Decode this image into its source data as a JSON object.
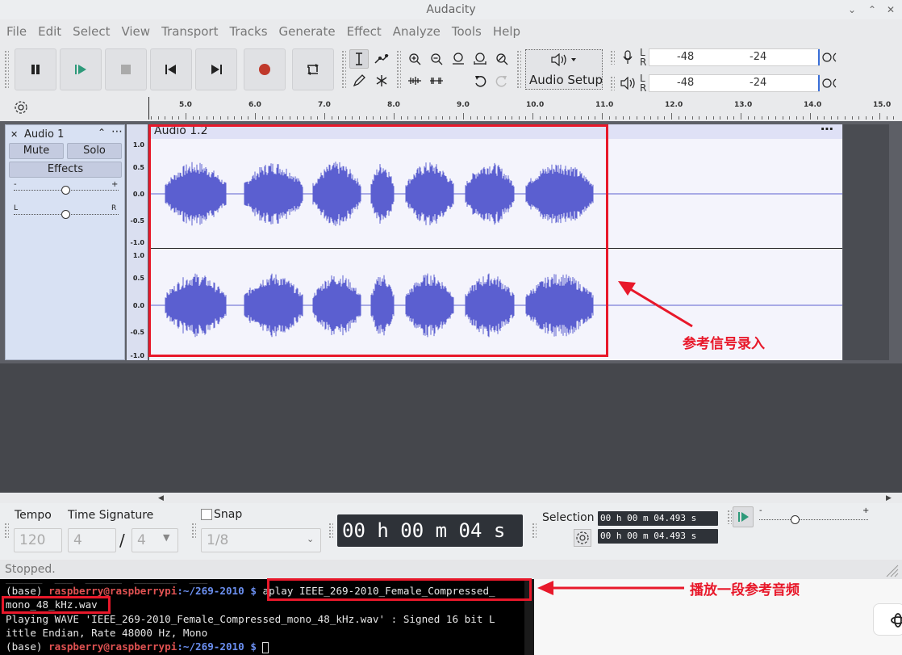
{
  "window": {
    "title": "Audacity"
  },
  "menu": [
    "File",
    "Edit",
    "Select",
    "View",
    "Transport",
    "Tracks",
    "Generate",
    "Effect",
    "Analyze",
    "Tools",
    "Help"
  ],
  "toolbar": {
    "audio_setup_label": "Audio Setup"
  },
  "meters": {
    "record": {
      "l": "L",
      "r": "R",
      "ticks": [
        "-48",
        "-24"
      ]
    },
    "playback": {
      "l": "L",
      "r": "R",
      "ticks": [
        "-48",
        "-24"
      ]
    }
  },
  "ruler": {
    "labels": [
      "5.0",
      "6.0",
      "7.0",
      "8.0",
      "9.0",
      "10.0",
      "11.0",
      "12.0",
      "13.0",
      "14.0",
      "15.0"
    ]
  },
  "track": {
    "name": "Audio 1",
    "mute": "Mute",
    "solo": "Solo",
    "effects": "Effects",
    "gain_minus": "-",
    "gain_plus": "+",
    "pan_left": "L",
    "pan_right": "R",
    "clip_name": "Audio 1.2",
    "vruler_upper": [
      "1.0",
      "0.5",
      "0.0",
      "-0.5",
      "-1.0"
    ],
    "vruler_lower": [
      "1.0",
      "0.5",
      "0.0",
      "-0.5",
      "-1.0"
    ]
  },
  "bottom": {
    "tempo_label": "Tempo",
    "tempo_value": "120",
    "time_sig_label": "Time Signature",
    "time_sig_num": "4",
    "time_sig_sep": "/",
    "time_sig_den": "4",
    "snap_label": "Snap",
    "snap_value": "1/8",
    "time_display": "00 h 00 m 04 s",
    "selection_label": "Selection",
    "selection_start": "00 h 00 m 04.493 s",
    "selection_end": "00 h 00 m 04.493 s",
    "play_speed_minus": "-",
    "play_speed_plus": "+"
  },
  "status": {
    "text": "Stopped."
  },
  "terminal": {
    "prompt_env": "(base) ",
    "user_host": "raspberry@raspberrypi",
    "path": ":~/269-2010 ",
    "dollar": "$ ",
    "command": "aplay IEEE_269-2010_Female_Compressed_",
    "command_cont": "mono_48_kHz.wav",
    "output_1": "Playing WAVE 'IEEE_269-2010_Female_Compressed_mono_48_kHz.wav' : Signed 16 bit L",
    "output_2": "ittle Endian, Rate 48000 Hz, Mono"
  },
  "annotations": {
    "reference_recording": "参考信号录入",
    "play_reference": "播放一段参考音频"
  },
  "colors": {
    "waveform": "#5b5fd0",
    "annotation": "#e8182a",
    "record_button": "#c0392b",
    "play_button": "#2e9a7a"
  }
}
